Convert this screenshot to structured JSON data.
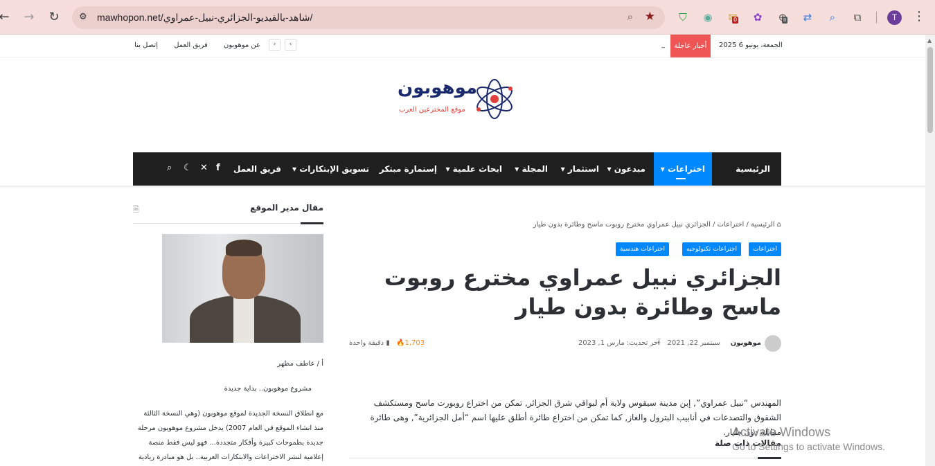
{
  "browser": {
    "url": "mawhopon.net/شاهد-بالفيديو-الجزائري-نبيل-عمراوي/",
    "avatar_letter": "T",
    "mail_badge": "0",
    "ext_badge": "II"
  },
  "topbar": {
    "date": "الجمعة، يونيو 6 2025",
    "breaking_label": "أخبار عاجلة",
    "breaking_text": "_",
    "links": [
      "عن موهوبون",
      "فريق العمل",
      "إتصل بنا"
    ]
  },
  "logo": {
    "title": "موهوبون",
    "subtitle": "موقع المخترعين العرب"
  },
  "nav": {
    "items": [
      "الرئيسية",
      "اختراعات",
      "مبدعون",
      "استثمار",
      "المجلة",
      "ابحاث علمية",
      "إستمارة مبتكر",
      "تسويق الإبتكارات",
      "فريق العمل"
    ],
    "active_index": 1
  },
  "article": {
    "breadcrumb": "الرئيسية / اختراعات / الجزائري نبيل عمراوي مخترع روبوت ماسح وطائرة بدون طيار",
    "tags": [
      "اختراعات",
      "اختراعات تكنولوجيه",
      "اختراعات هندسية"
    ],
    "title": "الجزائري نبيل عمراوي مخترع روبوت ماسح وطائرة بدون طيار",
    "author": "موهوبون",
    "date": "سبتمبر 22, 2021",
    "updated": "آخر تحديث: مارس 1, 2023",
    "views": "1,703",
    "read_time": "دقيقة واحدة",
    "body": "المهندس “نبيل عمراوي”, إبن مدينة سيقوس ولاية أم لبواقي شرق الجزائر, تمكن من اختراع روبورت ماسح ومستكشف الشقوق والتصدعات في أنابيب البترول والغاز, كما تمكن من اختراع طائرة أطلق عليها اسم “أمل الجزائرية”, وهى طائرة مقاتلة دون طيار.",
    "related_title": "مقالات ذات صلة"
  },
  "sidebar": {
    "title": "مقال مدير الموقع",
    "author": "أ / عاطف مظهر",
    "subtitle": "مشروع موهوبون.. بداية جديدة",
    "text": "مع انطلاق النسخة الجديدة لموقع موهوبون (وهي النسخة الثالثة منذ انشاء الموقع في العام 2007) يدخل مشروع موهوبون مرحلة جديدة بطموحات كبيرة وأفكار متجددة... فهو ليس فقط منصة إعلامية لنشر الاختراعات والابتكارات العربية.. بل هو مبادرة ريادية"
  },
  "watermark": {
    "line1": "Activate Windows",
    "line2": "Go to Settings to activate Windows."
  },
  "colors": {
    "accent": "#0088ff",
    "breaking": "#f05555",
    "nav_bg": "#1f1f1f",
    "views": "#f88a16"
  }
}
